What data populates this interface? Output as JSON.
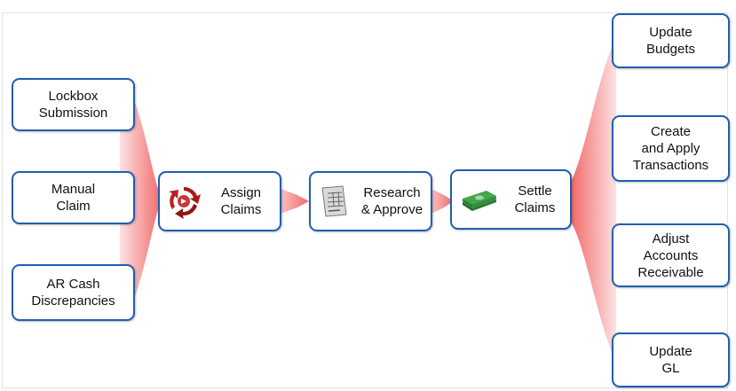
{
  "inputs": [
    {
      "label": "Lockbox\nSubmission"
    },
    {
      "label": "Manual\nClaim"
    },
    {
      "label": "AR Cash\nDiscrepancies"
    }
  ],
  "process": [
    {
      "label": "Assign\nClaims",
      "icon": "recycle-arrows-icon"
    },
    {
      "label": "Research\n& Approve",
      "icon": "document-form-icon"
    },
    {
      "label": "Settle\nClaims",
      "icon": "money-stack-icon"
    }
  ],
  "outputs": [
    {
      "label": "Update\nBudgets"
    },
    {
      "label": "Create\nand Apply\nTransactions"
    },
    {
      "label": "Adjust\nAccounts\nReceivable"
    },
    {
      "label": "Update\nGL"
    }
  ],
  "colors": {
    "border": "#1f5fb0",
    "funnel_dark": "#f26a6a",
    "funnel_light": "#fde2e2",
    "recycle": "#a51c1c",
    "money": "#2e8b3a"
  }
}
